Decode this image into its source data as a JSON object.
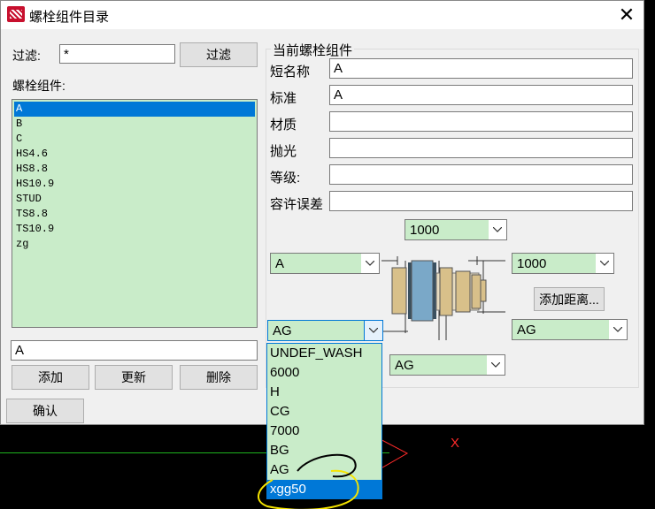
{
  "window": {
    "title": "螺栓组件目录",
    "close_glyph": "✕"
  },
  "left": {
    "filter_label": "过滤:",
    "filter_value": "*",
    "filter_button": "过滤",
    "list_label": "螺栓组件:",
    "items": [
      "A",
      "B",
      "C",
      "HS4.6",
      "HS8.8",
      "HS10.9",
      "STUD",
      "TS8.8",
      "TS10.9",
      "zg"
    ],
    "selected_index": 0,
    "name_value": "A",
    "add_button": "添加",
    "update_button": "更新",
    "delete_button": "删除",
    "confirm_button": "确认"
  },
  "right": {
    "group_title": "当前螺栓组件",
    "fields": [
      {
        "label": "短名称",
        "value": "A"
      },
      {
        "label": "标准",
        "value": "A"
      },
      {
        "label": "材质",
        "value": ""
      },
      {
        "label": "抛光",
        "value": ""
      },
      {
        "label": "等级:",
        "value": ""
      },
      {
        "label": "容许误差",
        "value": ""
      }
    ],
    "combo_top": "1000",
    "combo_left": "A",
    "combo_right": "1000",
    "add_distance_button": "添加距离...",
    "combo_bottom_left": "AG",
    "combo_bottom_right": "AG",
    "combo_bottom_mid": "AG"
  },
  "dropdown": {
    "options": [
      "UNDEF_WASH",
      "6000",
      "H",
      "CG",
      "7000",
      "BG",
      "AG",
      "xgg50"
    ],
    "highlighted_index": 7
  },
  "canvas": {
    "marker": "X",
    "line_color": "#1fb31f",
    "marker_color": "#ff2a2a",
    "annotation_color": "#f5e400"
  }
}
